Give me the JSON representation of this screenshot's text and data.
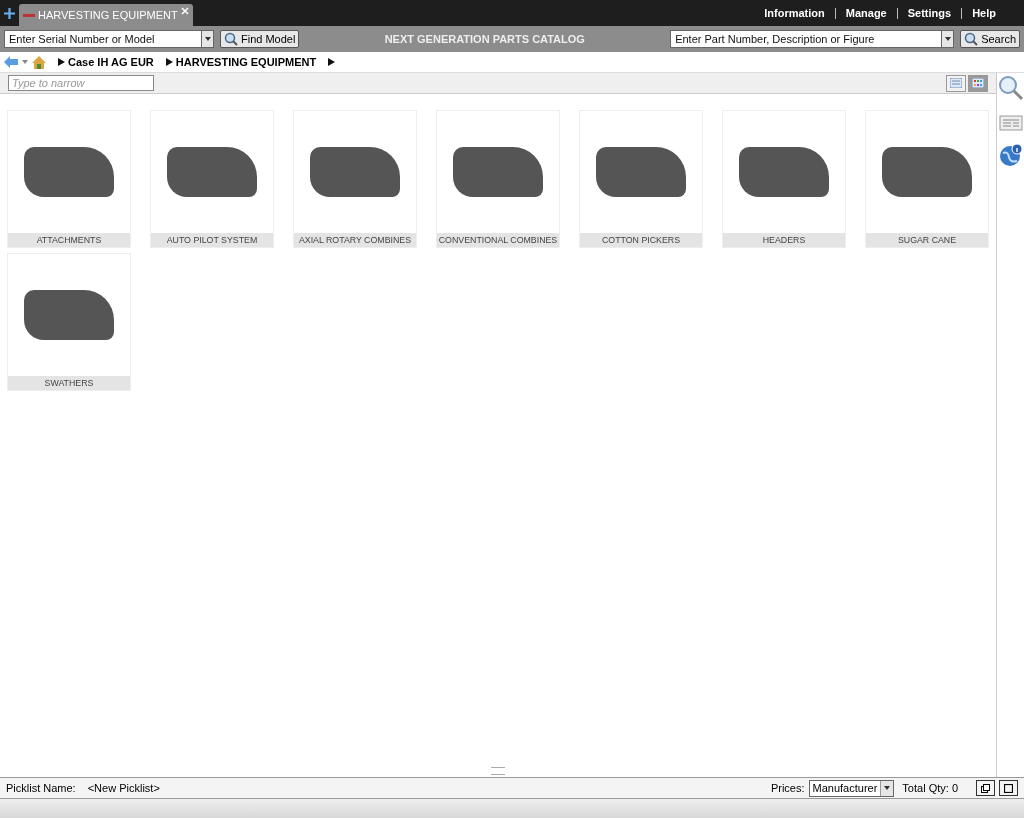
{
  "tabs": [
    {
      "label": "HARVESTING EQUIPMENT",
      "selected": true
    }
  ],
  "top_links": [
    "Information",
    "Manage",
    "Settings",
    "Help"
  ],
  "toolbar": {
    "model_field": {
      "placeholder": "Enter Serial Number or Model"
    },
    "find_button": "Find Model",
    "title": "NEXT GENERATION PARTS CATALOG",
    "part_field": {
      "placeholder": "Enter Part Number, Description or Figure"
    },
    "search_button": "Search"
  },
  "breadcrumb": [
    "Case IH AG EUR",
    "HARVESTING EQUIPMENT"
  ],
  "filter": {
    "placeholder": "Type to narrow"
  },
  "view_modes": [
    {
      "kind": "list",
      "selected": false
    },
    {
      "kind": "grid",
      "selected": true
    }
  ],
  "categories": [
    {
      "label": "ATTACHMENTS"
    },
    {
      "label": "AUTO PILOT SYSTEM"
    },
    {
      "label": "AXIAL ROTARY COMBINES"
    },
    {
      "label": "CONVENTIONAL COMBINES"
    },
    {
      "label": "COTTON PICKERS"
    },
    {
      "label": "HEADERS"
    },
    {
      "label": "SUGAR CANE"
    },
    {
      "label": "SWATHERS"
    }
  ],
  "picklist": {
    "label": "Picklist Name:",
    "name": "<New Picklist>",
    "prices_label": "Prices:",
    "prices_value": "Manufacturer",
    "total": "Total Qty: 0"
  }
}
